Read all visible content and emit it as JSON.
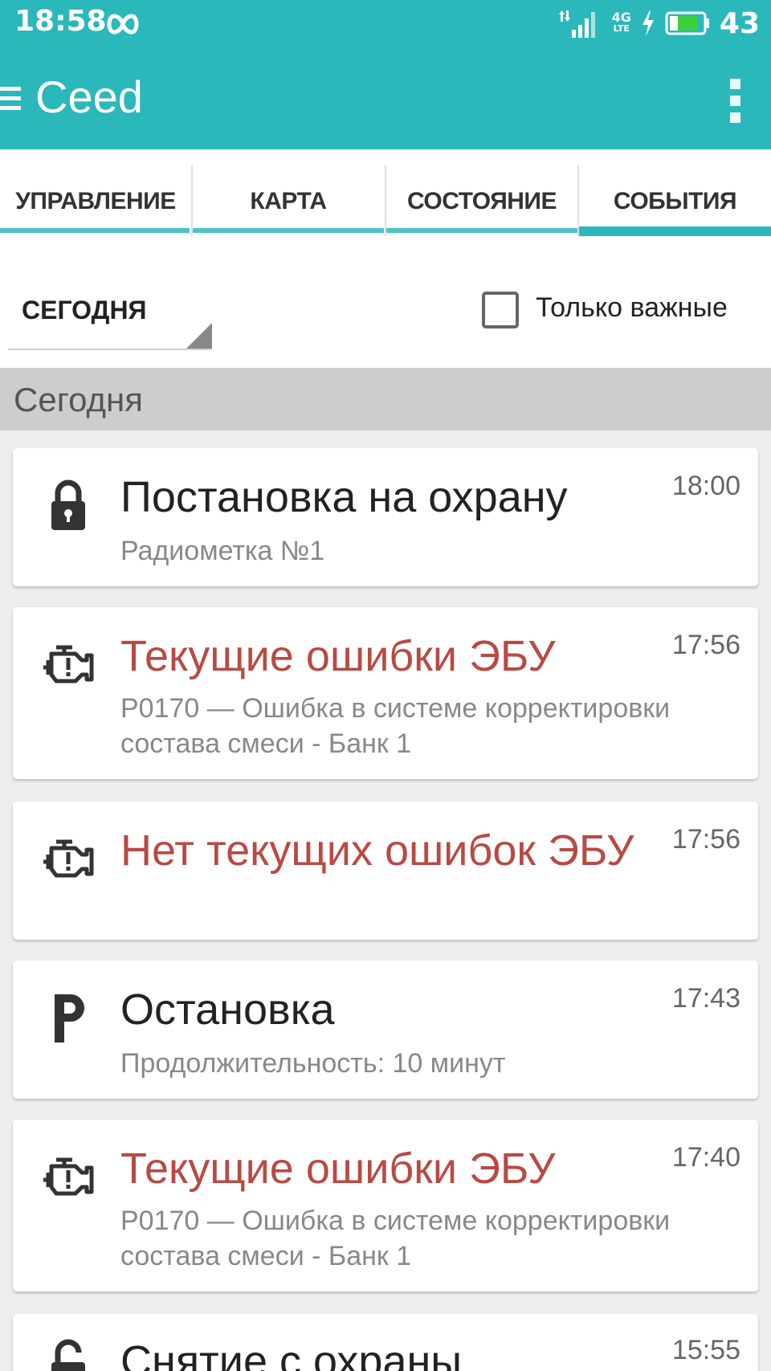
{
  "status_bar": {
    "time": "18:58",
    "battery_level": "43",
    "network_type": "4G",
    "network_sub": "LTE"
  },
  "app_bar": {
    "title": "Ceed"
  },
  "tabs": [
    {
      "label": "УПРАВЛЕНИЕ",
      "active": false
    },
    {
      "label": "КАРТА",
      "active": false
    },
    {
      "label": "СОСТОЯНИЕ",
      "active": false
    },
    {
      "label": "СОБЫТИЯ",
      "active": true
    }
  ],
  "filter": {
    "date_value": "СЕГОДНЯ",
    "important_only_label": "Только важные",
    "important_only_checked": false
  },
  "section": {
    "title": "Сегодня"
  },
  "events": [
    {
      "icon": "lock-icon",
      "title": "Постановка на охрану",
      "time": "18:00",
      "subtitle": "Радиометка №1",
      "alert": false
    },
    {
      "icon": "engine-icon",
      "title": "Текущие ошибки ЭБУ",
      "time": "17:56",
      "subtitle": "P0170 — Ошибка в системе корректировки состава смеси - Банк 1",
      "alert": true
    },
    {
      "icon": "engine-icon",
      "title": "Нет текущих ошибок ЭБУ",
      "time": "17:56",
      "subtitle": "",
      "alert": true
    },
    {
      "icon": "parking-icon",
      "title": "Остановка",
      "time": "17:43",
      "subtitle": "Продолжительность: 10 минут",
      "alert": false
    },
    {
      "icon": "engine-icon",
      "title": "Текущие ошибки ЭБУ",
      "time": "17:40",
      "subtitle": "P0170 — Ошибка в системе корректировки состава смеси - Банк 1",
      "alert": true
    },
    {
      "icon": "unlock-icon",
      "title": "Снятие с охраны",
      "time": "15:55",
      "subtitle": "",
      "alert": false
    }
  ],
  "colors": {
    "accent": "#2bb8bb",
    "alert_text": "#b84a43",
    "section_bg": "#cdcdcd",
    "battery_fill": "#3ecf3e"
  }
}
